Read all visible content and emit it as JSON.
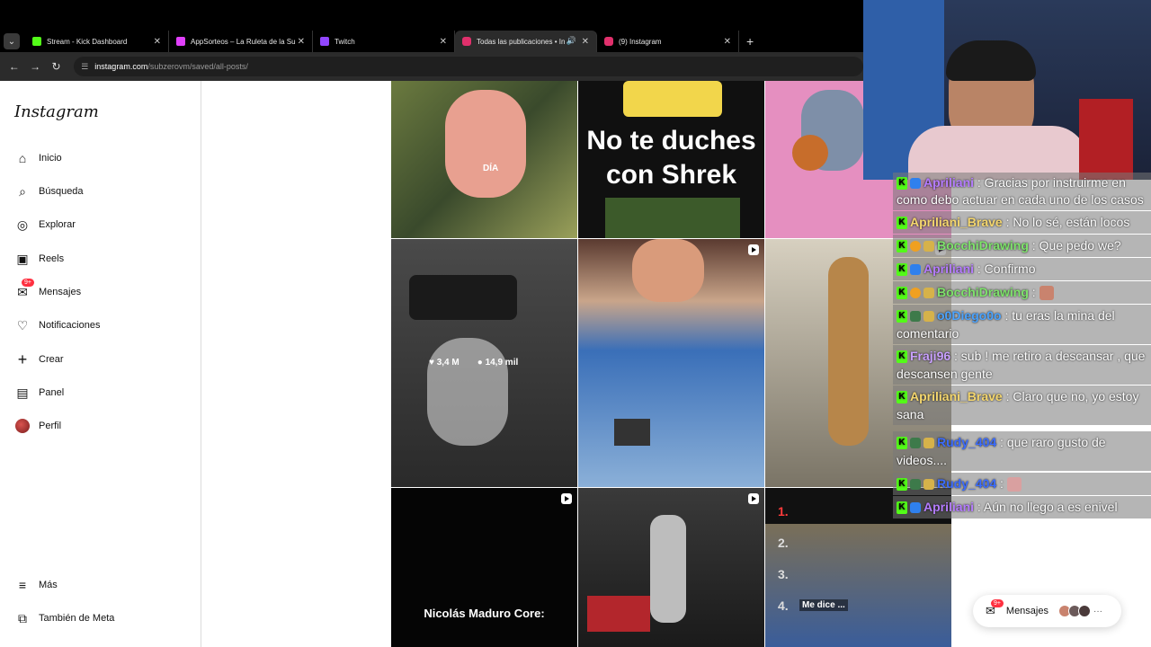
{
  "browser": {
    "tabs": [
      {
        "label": "Stream - Kick Dashboard",
        "fav_color": "#53fc18"
      },
      {
        "label": "AppSorteos – La Ruleta de la Su",
        "fav_color": "#e040fb"
      },
      {
        "label": "Twitch",
        "fav_color": "#9146ff"
      },
      {
        "label": "Todas las publicaciones • In",
        "fav_color": "#e1306c"
      },
      {
        "label": "(9) Instagram",
        "fav_color": "#e1306c"
      }
    ],
    "url_domain": "instagram.com",
    "url_path": "/subzerovm/saved/all-posts/"
  },
  "sidebar": {
    "logo": "Instagram",
    "items": [
      {
        "label": "Inicio",
        "icon": "home-icon"
      },
      {
        "label": "Búsqueda",
        "icon": "search-icon"
      },
      {
        "label": "Explorar",
        "icon": "compass-icon"
      },
      {
        "label": "Reels",
        "icon": "reels-icon"
      },
      {
        "label": "Mensajes",
        "icon": "messenger-icon",
        "badge": "9+"
      },
      {
        "label": "Notificaciones",
        "icon": "heart-icon"
      },
      {
        "label": "Crear",
        "icon": "plus-icon"
      },
      {
        "label": "Panel",
        "icon": "dashboard-icon"
      },
      {
        "label": "Perfil",
        "icon": "avatar"
      }
    ],
    "more": "Más",
    "meta": "También de Meta"
  },
  "grid": {
    "tile1_text": "DÍA",
    "tile2_text": "No te duches con Shrek",
    "tile4_likes": "3,4 M",
    "tile4_comments": "14,9 mil",
    "tile7_text": "Nicolás Maduro Core:",
    "tile9_caption": "Me dice ...",
    "tile9_rank": [
      "1.",
      "2.",
      "3.",
      "4."
    ]
  },
  "chat": [
    {
      "user": "Apriliani",
      "text": ": Gracias por instruirme en como debo actuar en cada uno de los casos",
      "color": "#b57cff"
    },
    {
      "user": "Apriliani_Brave",
      "text": ": No lo sé, están locos",
      "color": "#f5d76e"
    },
    {
      "user": "BocchiDrawing",
      "text": ": Que pedo we?",
      "color": "#7ee36b"
    },
    {
      "user": "Apriliani",
      "text": ": Confirmo",
      "color": "#b57cff"
    },
    {
      "user": "BocchiDrawing",
      "text": ":",
      "color": "#7ee36b"
    },
    {
      "user": "o0Diego0o",
      "text": ": tu eras la mina del comentario",
      "color": "#4aa3ff"
    },
    {
      "user": "Fraji96",
      "text": ": sub ! me retiro a descansar , que descansen gente",
      "color": "#c9a0ff"
    },
    {
      "user": "Apriliani_Brave",
      "text": ": Claro que no, yo estoy sana",
      "color": "#f5d76e"
    },
    {
      "user": "Rudy_404",
      "text": ": que raro gusto de videos....",
      "color": "#3b6cff"
    },
    {
      "user": "Rudy_404",
      "text": ":",
      "color": "#3b6cff"
    },
    {
      "user": "Apriliani",
      "text": ": Aún no llego a es enivel",
      "color": "#b57cff"
    }
  ],
  "messages_pill": {
    "label": "Mensajes",
    "badge": "9+"
  }
}
